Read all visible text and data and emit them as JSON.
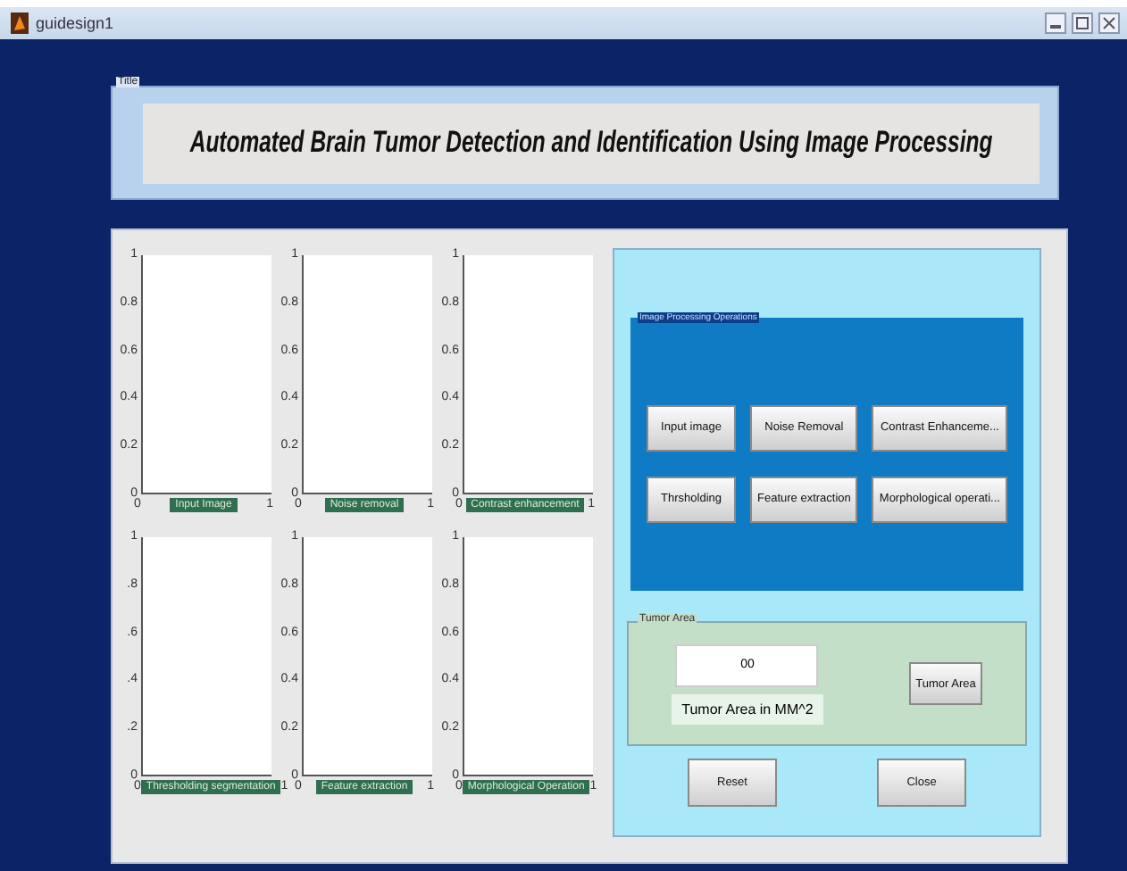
{
  "window": {
    "title": "guidesign1"
  },
  "title_panel": {
    "tag": "Title",
    "text": "Automated Brain Tumor Detection and Identification Using Image Processing"
  },
  "plots": [
    {
      "yticks": [
        "1",
        "0.8",
        "0.6",
        "0.4",
        "0.2",
        "0"
      ],
      "xticks": [
        "0",
        "1"
      ],
      "label": "Input Image"
    },
    {
      "yticks": [
        "1",
        "0.8",
        "0.6",
        "0.4",
        "0.2",
        "0"
      ],
      "xticks": [
        "0",
        "1"
      ],
      "label": "Noise removal"
    },
    {
      "yticks": [
        "1",
        "0.8",
        "0.6",
        "0.4",
        "0.2",
        "0"
      ],
      "xticks": [
        "0",
        "1"
      ],
      "label": "Contrast enhancement"
    },
    {
      "yticks": [
        "1",
        ".8",
        ".6",
        ".4",
        ".2",
        "0"
      ],
      "xticks": [
        "0",
        "1"
      ],
      "label": "Thresholding segmentation"
    },
    {
      "yticks": [
        "1",
        "0.8",
        "0.6",
        "0.4",
        "0.2",
        "0"
      ],
      "xticks": [
        "0",
        "1"
      ],
      "label": "Feature extraction"
    },
    {
      "yticks": [
        "1",
        "0.8",
        "0.6",
        "0.4",
        "0.2",
        "0"
      ],
      "xticks": [
        "0",
        "1"
      ],
      "label": "Morphological Operation"
    }
  ],
  "operations": {
    "label": "Image Processing Operations",
    "buttons": [
      "Input image",
      "Noise Removal",
      "Contrast Enhanceme...",
      "Thrsholding",
      "Feature extraction",
      "Morphological operati..."
    ]
  },
  "tumor_area": {
    "label": "Tumor Area",
    "value": "00",
    "caption": "Tumor Area in MM^2",
    "button": "Tumor Area"
  },
  "buttons": [
    "Reset",
    "Close"
  ]
}
